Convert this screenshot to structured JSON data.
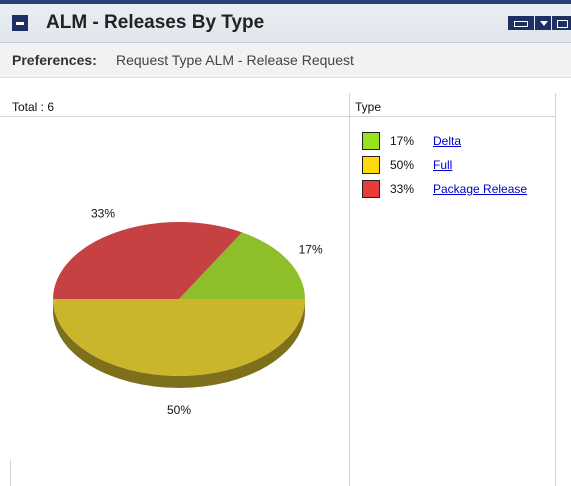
{
  "header": {
    "title": "ALM - Releases By Type",
    "collapse_icon": "collapse-icon",
    "controls": [
      "edit-icon",
      "menu-dropdown-icon",
      "maximize-icon"
    ],
    "accent_color": "#1e2f63"
  },
  "preferences": {
    "label": "Preferences:",
    "value": "Request Type ALM - Release Request"
  },
  "chart_meta": {
    "total_text": "Total : 6",
    "legend_header": "Type"
  },
  "chart_data": {
    "type": "pie",
    "title": "",
    "total": 6,
    "slices": [
      {
        "name": "Delta",
        "value": 1,
        "percent": 17,
        "percent_label": "17%",
        "color": "#8ebf2a"
      },
      {
        "name": "Full",
        "value": 3,
        "percent": 50,
        "percent_label": "50%",
        "color": "#cbb52a"
      },
      {
        "name": "Package Release",
        "value": 2,
        "percent": 33,
        "percent_label": "33%",
        "color": "#c64141"
      }
    ],
    "legend": [
      {
        "percent_label": "17%",
        "name": "Delta",
        "swatch_color": "#99e21e"
      },
      {
        "percent_label": "50%",
        "name": "Full",
        "swatch_color": "#ffd90a"
      },
      {
        "percent_label": "33%",
        "name": "Package Release",
        "swatch_color": "#ea3b3b"
      }
    ],
    "style": "3d-tilted",
    "legend_position": "right"
  }
}
